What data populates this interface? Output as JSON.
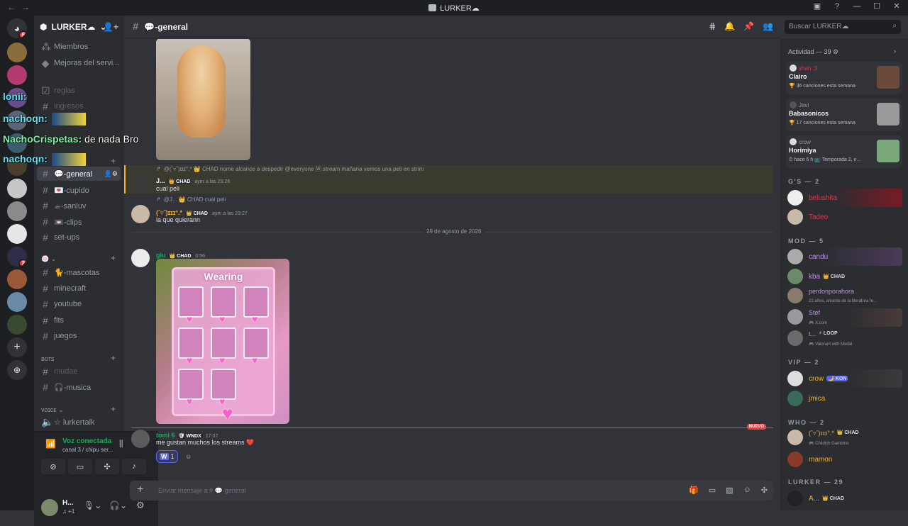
{
  "window": {
    "title": "LURKER☁︎"
  },
  "server": {
    "name": "LURKER☁︎",
    "badge_home": "6",
    "badge_srv": "2"
  },
  "sidebar": {
    "top_items": [
      "Miembros",
      "Mejoras del servi..."
    ],
    "channels": [
      {
        "label": "reglas",
        "style": "muted"
      },
      {
        "label": "ingresos",
        "style": "muted"
      },
      {
        "label": "💬-general",
        "style": "active"
      },
      {
        "label": "💌-cupido",
        "style": "normal"
      },
      {
        "label": "☕-sanluv",
        "style": "normal"
      },
      {
        "label": "📼-clips",
        "style": "normal"
      },
      {
        "label": "set-ups",
        "style": "normal"
      },
      {
        "label": "🐈-mascotas",
        "style": "normal"
      },
      {
        "label": "minecraft",
        "style": "normal"
      },
      {
        "label": "youtube",
        "style": "normal"
      },
      {
        "label": "fits",
        "style": "normal"
      },
      {
        "label": "juegos",
        "style": "normal"
      },
      {
        "label": "mudae",
        "style": "muted"
      },
      {
        "label": "🎧-musica",
        "style": "normal"
      },
      {
        "label": "☆ lurkertalk",
        "style": "normal"
      }
    ],
    "categories": [
      "🍥 ⌄",
      "ʙoᴛs",
      "ᴠoɪᴄᴇ ⌄"
    ],
    "voice": {
      "status": "Voz conectada",
      "sub": "canal 3 / chipu ser..."
    },
    "user": {
      "name": "H...",
      "sub": "♫ +1"
    }
  },
  "overlay": [
    {
      "user": "lonii:",
      "text": ""
    },
    {
      "user": "nachoqn:",
      "text": ""
    },
    {
      "user": "NachoCrispetas:",
      "text": " de nada Bro"
    },
    {
      "user": "nachoqn:",
      "text": ""
    }
  ],
  "chat": {
    "channel": "💬-general",
    "search_placeholder": "Buscar LURKER☁︎",
    "date_divider": "29 de agosto de 2026",
    "new_label": "NUEVO",
    "input_placeholder": "Enviar mensaje a # 💬-general",
    "messages": [
      {
        "reply": "@(ˆ▿ˆ)ɪɪɪ°.* 👑 CHAD  nome alcance a despedir @everyone 🅆 stream mañana vemos una peli en strim",
        "user": "J...",
        "tag": "👑 CHAD",
        "time": "ayer a las 23:26",
        "text": "cual peli"
      },
      {
        "reply": "@J... 👑 CHAD  cual peli",
        "user": "(ˆ▿ˆ)ɪɪɪ°.*",
        "tag": "👑 CHAD",
        "time": "ayer a las 23:27",
        "text": "la que quierann"
      },
      {
        "user": "giu",
        "tag": "👑 CHAD",
        "time": "0:56",
        "text": ""
      },
      {
        "user": "tomi 6",
        "tag": "🛡 WNDX",
        "time": "17:07",
        "text": "me gustan muchos los streams ❤️"
      }
    ],
    "image_text": "Wearing",
    "reaction": {
      "emoji": "W",
      "count": "1"
    }
  },
  "members": {
    "activity_header": "Actividad — 39 ⚙",
    "activities": [
      {
        "user": "shan :3",
        "title": "Clairo",
        "sub": "🏆 36 canciones esta semana"
      },
      {
        "user": "Javi",
        "title": "Babasonicos",
        "sub": "🏆 17 canciones esta semana"
      },
      {
        "user": "crow",
        "title": "Horimiya",
        "sub": "⏱ hace 6 h  📺 Temporada 2, e..."
      }
    ],
    "groups": [
      {
        "label": "G'S — 2",
        "members": [
          {
            "name": "belushita",
            "color": "#e8334a",
            "tag": "",
            "status": ""
          },
          {
            "name": "Tadeo",
            "color": "#e8334a",
            "tag": "",
            "status": ""
          }
        ]
      },
      {
        "label": "MOD — 5",
        "members": [
          {
            "name": "candu",
            "color": "#c58cf2",
            "tag": "",
            "status": ""
          },
          {
            "name": "kba",
            "color": "#c58cf2",
            "tag": "👑 CHAD",
            "status": ""
          },
          {
            "name": "perdonporahora",
            "color": "#c58cf2",
            "tag": "",
            "status": "21 años, amante de la literatura fe..."
          },
          {
            "name": "Stef",
            "color": "#c58cf2",
            "tag": "",
            "status": "🎮 X.com"
          },
          {
            "name": "t...",
            "color": "#c58cf2",
            "tag": "⚡ LOOP",
            "status": "🎮 Valorant with Medal"
          }
        ]
      },
      {
        "label": "VIP — 2",
        "members": [
          {
            "name": "crow",
            "color": "#f0b232",
            "tag": "🌙 KON",
            "status": ""
          },
          {
            "name": "jmica",
            "color": "#f0b232",
            "tag": "",
            "status": ""
          }
        ]
      },
      {
        "label": "WHO — 2",
        "members": [
          {
            "name": "(ˆ▿ˆ)ɪɪɪ°.*",
            "color": "#f0b232",
            "tag": "👑 CHAD",
            "status": "🎮 Childish Gambino"
          },
          {
            "name": "mamon",
            "color": "#f0b232",
            "tag": "",
            "status": ""
          }
        ]
      },
      {
        "label": "LURKER — 29",
        "members": [
          {
            "name": "A...",
            "color": "#f0b232",
            "tag": "👑 CHAD",
            "status": ""
          }
        ]
      }
    ]
  }
}
